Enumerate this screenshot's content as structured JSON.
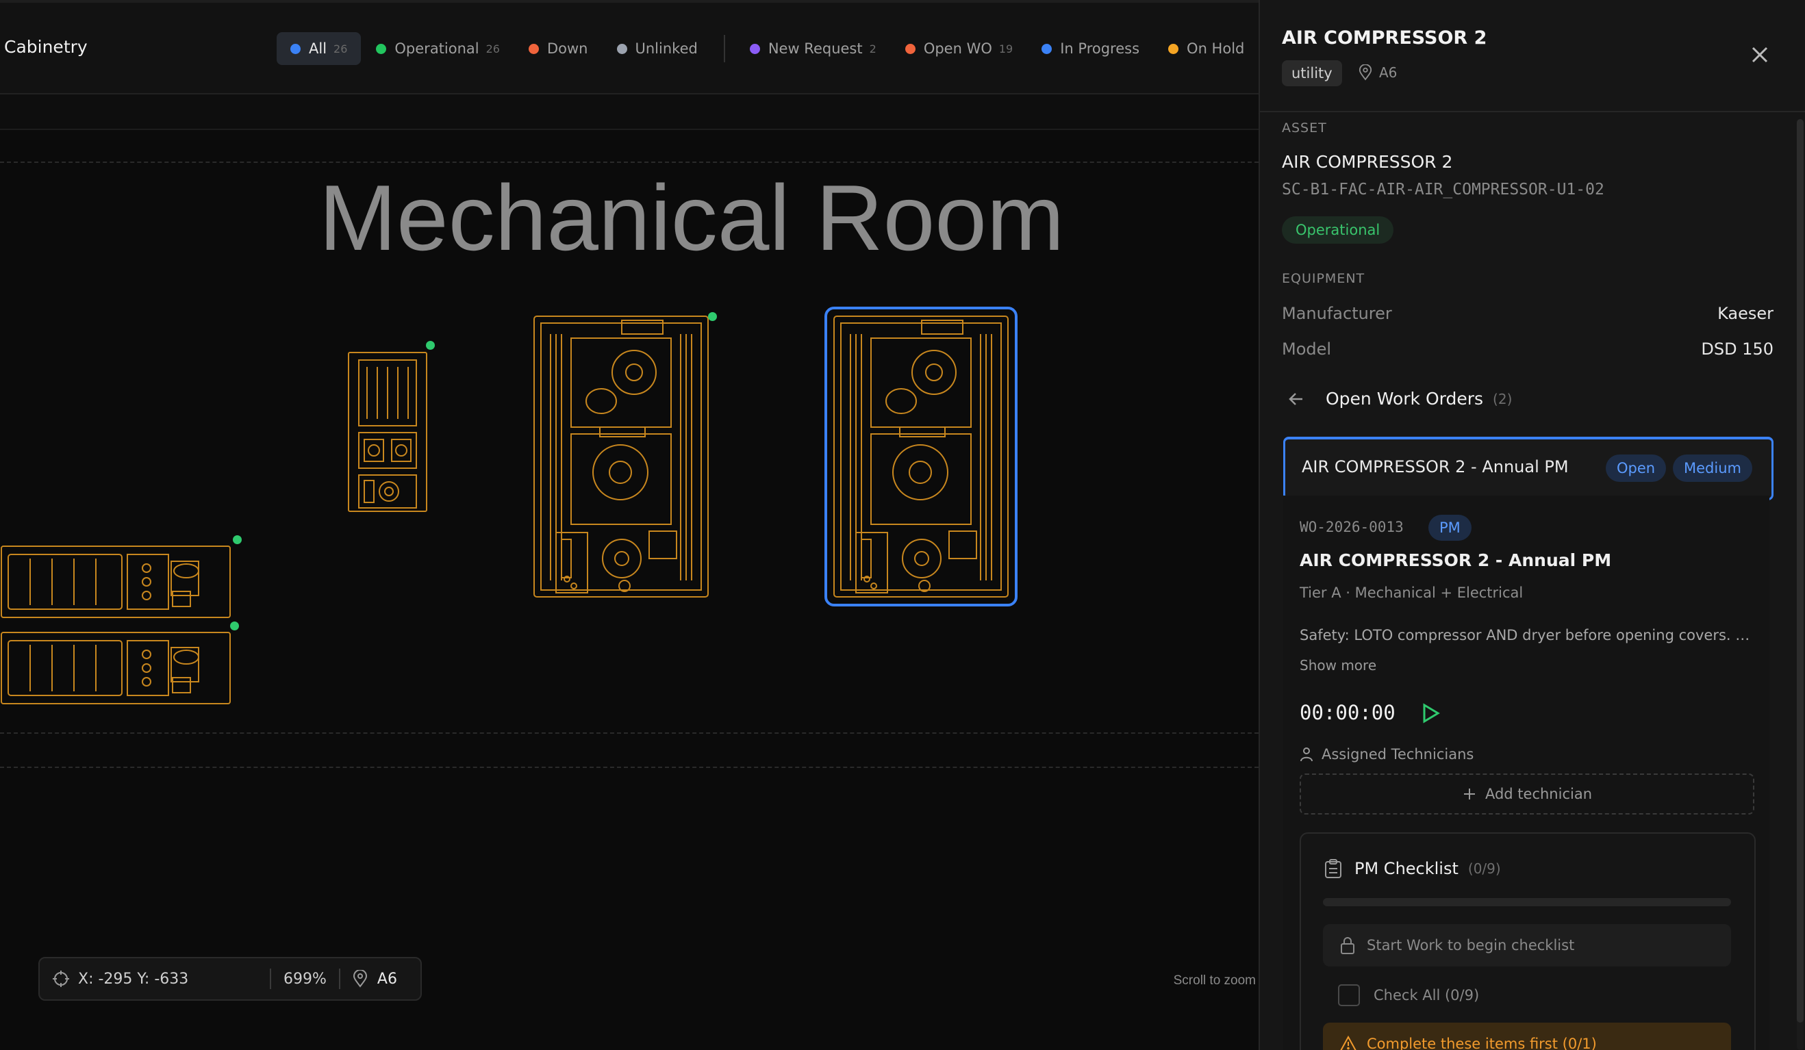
{
  "toolbar": {
    "title": "Cabinetry",
    "filters": [
      {
        "label": "All",
        "count": "26",
        "color": "#3b82f6"
      },
      {
        "label": "Operational",
        "count": "26",
        "color": "#22c55e"
      },
      {
        "label": "Down",
        "count": "",
        "color": "#f0643c"
      },
      {
        "label": "Unlinked",
        "count": "",
        "color": "#9ca3af"
      },
      {
        "label": "New Request",
        "count": "2",
        "color": "#8b5cf6"
      },
      {
        "label": "Open WO",
        "count": "19",
        "color": "#f0643c"
      },
      {
        "label": "In Progress",
        "count": "",
        "color": "#3b82f6"
      },
      {
        "label": "On Hold",
        "count": "",
        "color": "#f5a524"
      }
    ]
  },
  "canvas": {
    "room_title": "Mechanical Room",
    "coords": "X: -295 Y: -633",
    "zoom": "699%",
    "location": "A6",
    "scroll_hint": "Scroll to zoom",
    "equipment_color": "#c8871e",
    "status_color": "#2fca6e",
    "selected_color": "#3b82f6"
  },
  "panel": {
    "title": "AIR COMPRESSOR 2",
    "tag": "utility",
    "location": "A6",
    "asset_label": "ASSET",
    "asset_name": "AIR COMPRESSOR 2",
    "asset_code": "SC-B1-FAC-AIR-AIR_COMPRESSOR-U1-02",
    "status": "Operational",
    "equipment_label": "EQUIPMENT",
    "manufacturer_key": "Manufacturer",
    "manufacturer_val": "Kaeser",
    "model_key": "Model",
    "model_val": "DSD 150",
    "open_wo_label": "Open Work Orders",
    "open_wo_count": "(2)",
    "wo_card": {
      "title": "AIR COMPRESSOR 2 - Annual PM",
      "status": "Open",
      "priority": "Medium"
    },
    "wo_detail": {
      "id": "WO-2026-0013",
      "type": "PM",
      "title": "AIR COMPRESSOR 2 - Annual PM",
      "subtitle": "Tier A · Mechanical + Electrical",
      "safety": "Safety: LOTO compressor AND dryer before opening covers. Bleed ...",
      "show_more": "Show more",
      "timer": "00:00:00",
      "assigned_label": "Assigned Technicians",
      "add_technician": "Add technician",
      "checklist_title": "PM Checklist",
      "checklist_count": "(0/9)",
      "locked_text": "Start Work to begin checklist",
      "check_all": "Check All (0/9)",
      "warning": "Complete these items first (0/1)"
    }
  }
}
